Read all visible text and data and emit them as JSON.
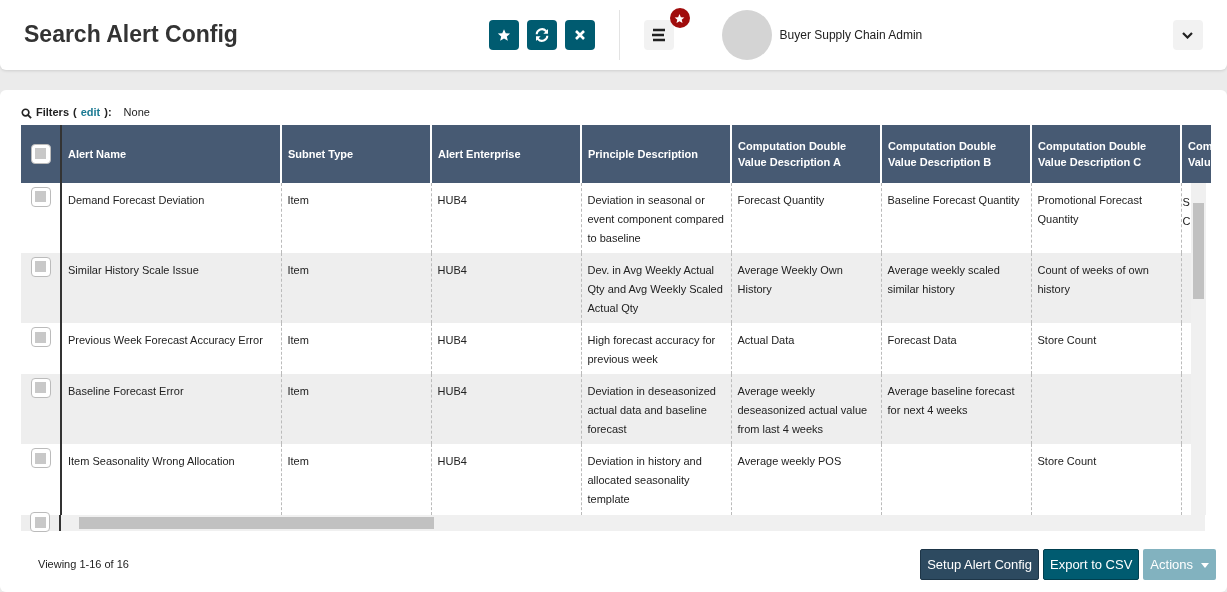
{
  "page_title": "Search Alert Config",
  "toolbar": [
    {
      "kind": "star"
    },
    {
      "kind": "refresh"
    },
    {
      "kind": "close"
    }
  ],
  "menu": {
    "badge": true
  },
  "user": {
    "role": "Buyer Supply Chain Admin"
  },
  "filters": {
    "label": "Filters",
    "open": "(",
    "edit": "edit",
    "close": "):",
    "value": "None"
  },
  "table": {
    "select_all_checked": false,
    "columns": [
      "Alert Name",
      "Subnet Type",
      "Alert Enterprise",
      "Principle Description",
      "Computation Double Value Description A",
      "Computation Double Value Description B",
      "Computation Double Value Description C",
      "Com Valu"
    ],
    "rows": [
      {
        "checked": false,
        "cells": [
          "Demand Forecast Deviation",
          "Item",
          "HUB4",
          "Deviation in seasonal or event component compared to baseline",
          "Forecast Quantity",
          "Baseline Forecast Quantity",
          "Promotional Forecast Quantity",
          "S C"
        ]
      },
      {
        "checked": false,
        "cells": [
          "Similar History Scale Issue",
          "Item",
          "HUB4",
          "Dev. in Avg Weekly Actual Qty and Avg Weekly Scaled Actual Qty",
          "Average Weekly Own History",
          "Average weekly scaled similar history",
          "Count of weeks of own history",
          ""
        ]
      },
      {
        "checked": false,
        "cells": [
          "Previous Week Forecast Accuracy Error",
          "Item",
          "HUB4",
          "High forecast accuracy for previous week",
          "Actual Data",
          "Forecast Data",
          "Store Count",
          ""
        ]
      },
      {
        "checked": false,
        "cells": [
          "Baseline Forecast Error",
          "Item",
          "HUB4",
          "Deviation in deseasonized actual data and baseline forecast",
          "Average weekly deseasonized actual value from last 4 weeks",
          "Average baseline forecast for next 4 weeks",
          "",
          ""
        ]
      },
      {
        "checked": false,
        "cells": [
          "Item Seasonality Wrong Allocation",
          "Item",
          "HUB4",
          "Deviation in history and allocated seasonality template",
          "Average weekly POS",
          "",
          "Store Count",
          ""
        ]
      },
      {
        "checked": false,
        "cells": []
      }
    ]
  },
  "footer": {
    "viewing": "Viewing 1-16 of 16",
    "buttons": [
      {
        "label": "Setup Alert Config",
        "kind": "dark",
        "disabled": false
      },
      {
        "label": "Export to CSV",
        "kind": "primary",
        "disabled": false
      },
      {
        "label": "Actions",
        "kind": "dropdown",
        "disabled": true
      }
    ]
  }
}
